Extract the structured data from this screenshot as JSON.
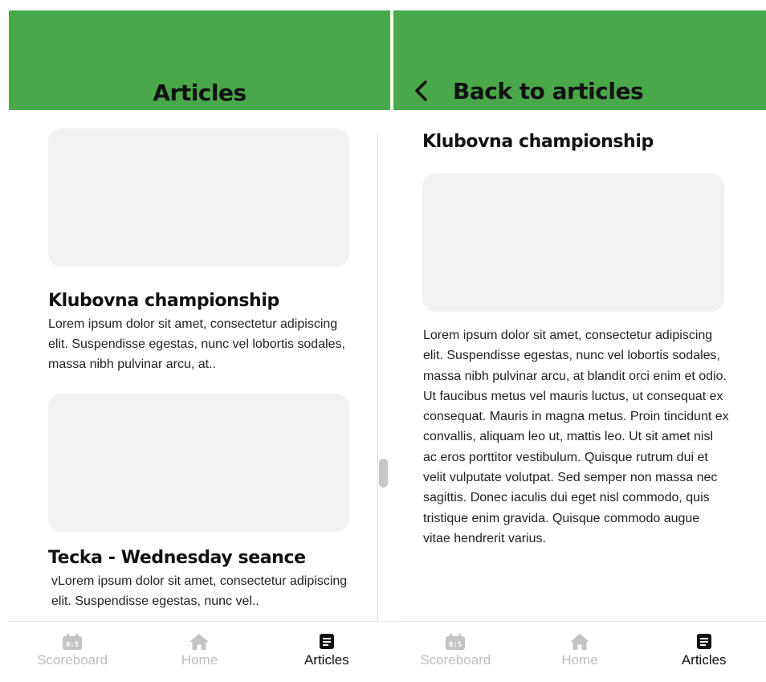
{
  "list_screen": {
    "header": {
      "title": "Articles"
    },
    "articles": [
      {
        "title": "Klubovna championship",
        "excerpt": "Lorem ipsum dolor sit amet, consectetur adipiscing elit. Suspendisse egestas, nunc vel lobortis sodales, massa nibh pulvinar arcu, at.."
      },
      {
        "title": "Tecka - Wednesday seance",
        "excerpt": "vLorem ipsum dolor sit amet, consectetur adipiscing elit. Suspendisse egestas, nunc vel.."
      }
    ]
  },
  "detail_screen": {
    "header": {
      "back_label": "Back to articles"
    },
    "article": {
      "title": "Klubovna championship",
      "body": "Lorem ipsum dolor sit amet, consectetur adipiscing elit. Suspendisse egestas, nunc vel lobortis sodales, massa nibh pulvinar arcu, at blandit orci enim et odio. Ut faucibus metus vel mauris luctus, ut consequat ex consequat. Mauris in magna metus. Proin tincidunt ex convallis, aliquam leo ut, mattis leo. Ut sit amet nisl ac eros porttitor vestibulum. Quisque rutrum dui et velit vulputate volutpat. Sed semper non massa nec sagittis. Donec iaculis dui eget nisl commodo, quis tristique enim gravida. Quisque commodo augue vitae hendrerit varius."
    }
  },
  "bottom_nav": {
    "items": [
      {
        "label": "Scoreboard",
        "icon": "scoreboard-icon",
        "active": false
      },
      {
        "label": "Home",
        "icon": "home-icon",
        "active": false
      },
      {
        "label": "Articles",
        "icon": "articles-icon",
        "active": true
      }
    ]
  },
  "colors": {
    "brand_green": "#49a84a",
    "placeholder_gray": "#f2f2f2",
    "inactive_nav": "#bdbdbd",
    "active_nav": "#111111"
  }
}
